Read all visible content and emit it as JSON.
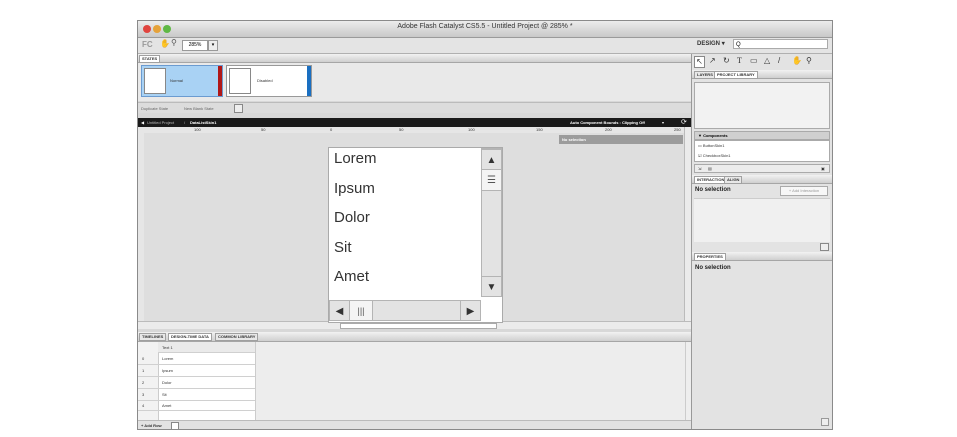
{
  "window": {
    "title": "Adobe Flash Catalyst CS5.5 - Untitled Project @ 285% *"
  },
  "toolbar": {
    "zoom_value": "285%",
    "zoom_arrow": "▾",
    "workspace": "DESIGN",
    "workspace_arrow": "▾",
    "search_icon_glyph": "Q",
    "logo": "FC"
  },
  "states": {
    "header": "STATES",
    "items": [
      {
        "label": "Normal"
      },
      {
        "label": "Disabled"
      }
    ],
    "duplicate_label": "Duplicate State",
    "new_blank_label": "New Blank State"
  },
  "breadcrumb": {
    "project": "Untitled Project",
    "separator": "/",
    "current": "DataListSkin1",
    "bounds_label": "Auto Component Bounds : Clipping Off",
    "bounds_arrow": "▾"
  },
  "ruler": {
    "ticks": [
      "100",
      "50",
      "0",
      "50",
      "100",
      "150",
      "200",
      "250"
    ]
  },
  "artboard": {
    "items": [
      "Lorem",
      "Ipsum",
      "Dolor",
      "Sit",
      "Amet"
    ],
    "no_selection": "No selection"
  },
  "bottom_panel": {
    "tabs": [
      "TIMELINES",
      "DESIGN-TIME DATA",
      "COMMON LIBRARY"
    ],
    "column_header": "Text 1",
    "rows": [
      {
        "index": "0",
        "value": "Lorem"
      },
      {
        "index": "1",
        "value": "Ipsum"
      },
      {
        "index": "2",
        "value": "Dolor"
      },
      {
        "index": "3",
        "value": "Sit"
      },
      {
        "index": "4",
        "value": "Amet"
      }
    ],
    "add_row_label": "+ Add Row"
  },
  "right_panel": {
    "layers_tabs": [
      "LAYERS",
      "PROJECT LIBRARY"
    ],
    "components_header": "Components",
    "components": [
      "ButtonSkin1",
      "CheckboxSkin1"
    ],
    "interactions_tabs": [
      "INTERACTIONS",
      "ALIGN"
    ],
    "interactions_no_selection": "No selection",
    "add_interaction_label": "+ Add Interaction",
    "properties_tab": "PROPERTIES",
    "properties_no_selection": "No selection"
  }
}
